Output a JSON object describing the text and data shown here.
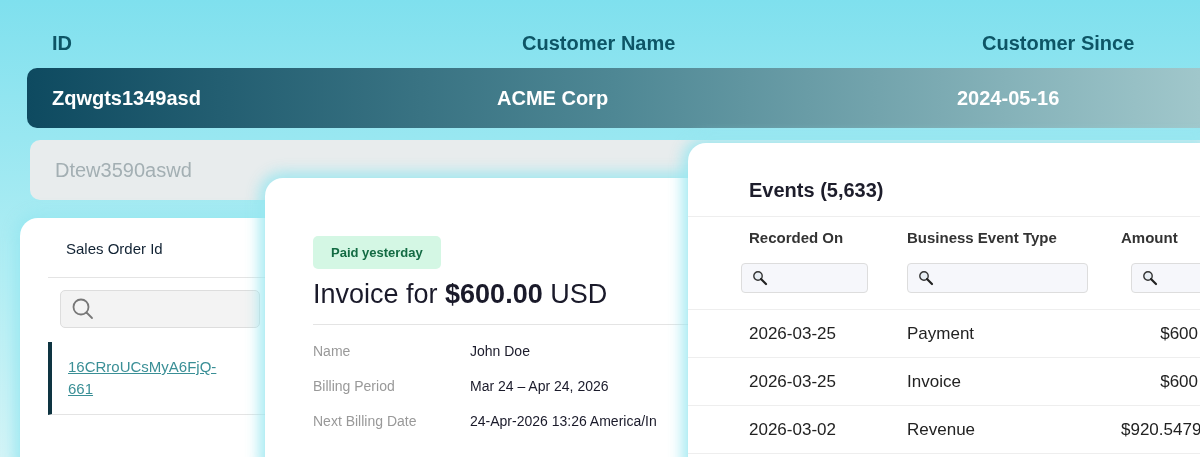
{
  "customers": {
    "columns": [
      "ID",
      "Customer Name",
      "Customer Since"
    ],
    "rows": [
      {
        "id": "Zqwgts1349asd",
        "name": "ACME Corp",
        "since": "2024-05-16",
        "selected": true
      },
      {
        "id": "Dtew3590aswd",
        "selected": false
      }
    ]
  },
  "sales_orders": {
    "title": "Sales Order Id",
    "items": [
      {
        "label": "16CRroUCsMyA6FjQ-661",
        "selected": true
      }
    ]
  },
  "invoice": {
    "badge": "Paid yesterday",
    "title": "Invoice for **$600.00** USD",
    "fields": [
      {
        "label": "Name",
        "value": "John Doe"
      },
      {
        "label": "Billing Period",
        "value": "Mar 24 – Apr 24, 2026"
      },
      {
        "label": "Next Billing Date",
        "value": "24-Apr-2026 13:26 America/In"
      }
    ]
  },
  "events": {
    "title": "Events (5,633)",
    "columns": [
      "Recorded On",
      "Business Event Type",
      "Amount"
    ],
    "rows": [
      [
        "2026-03-25",
        "Payment",
        "$600"
      ],
      [
        "2026-03-25",
        "Invoice",
        "$600"
      ],
      [
        "2026-03-02",
        "Revenue",
        "$920.5479"
      ]
    ]
  }
}
